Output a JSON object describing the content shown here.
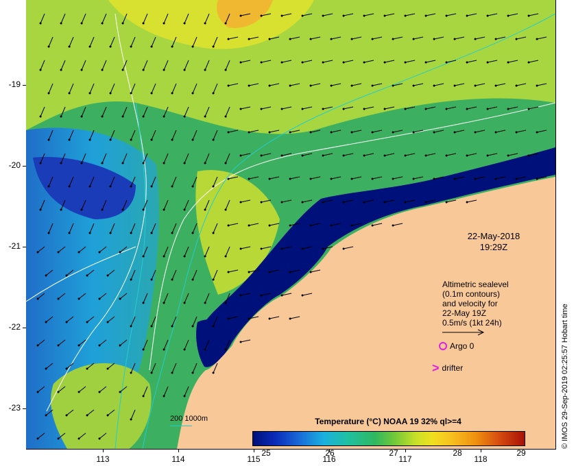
{
  "map": {
    "date": "22-May-2018",
    "time": "19:29Z",
    "lat_ticks": [
      "-19",
      "-20",
      "-21",
      "-22",
      "-23"
    ],
    "lon_ticks": [
      "113",
      "114",
      "115",
      "116",
      "117",
      "118"
    ],
    "lon_range": [
      112.0,
      119.0
    ],
    "lat_range": [
      -23.55,
      -18.0
    ],
    "land_color": "#f8c898",
    "ocean_cold_color": "#00107a"
  },
  "altimetry_note": {
    "line1": "Altimetric sealevel",
    "line2": "(0.1m contours)",
    "line3": "and velocity for",
    "line4": "22-May 19Z",
    "line5": "0.5m/s (1kt 24h)"
  },
  "legend": {
    "argo_label": "Argo 0",
    "drifter_label": "drifter",
    "marker_color": "#e020e0",
    "contour_label": "200  1000m",
    "contour_color": "#22cccc"
  },
  "colorbar": {
    "title": "Temperature (°C) NOAA 19 32% ql>=4",
    "ticks": [
      "25",
      "26",
      "27",
      "28",
      "29"
    ],
    "range": [
      24.85,
      29.1
    ]
  },
  "credit": "© IMOS 29-Sep-2019 02:25:57 Hobart time"
}
